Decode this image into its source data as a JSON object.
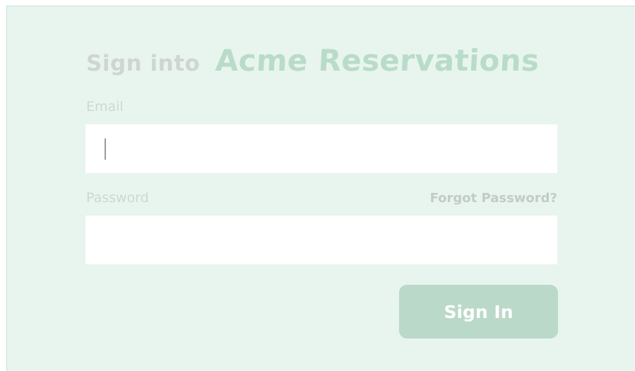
{
  "header": {
    "title_prefix": "Sign into",
    "brand_name": "Acme Reservations"
  },
  "form": {
    "email_label": "Email",
    "email_value": "",
    "email_placeholder": "",
    "password_label": "Password",
    "password_value": "",
    "password_placeholder": "",
    "forgot_password_label": "Forgot Password?",
    "submit_label": "Sign In"
  },
  "colors": {
    "panel_background": "#e8f5ee",
    "brand_text": "#b9dcc8",
    "muted_text": "#cfd6d2",
    "button_background": "#bad9c9",
    "button_text": "#ffffff",
    "input_background": "#ffffff"
  }
}
